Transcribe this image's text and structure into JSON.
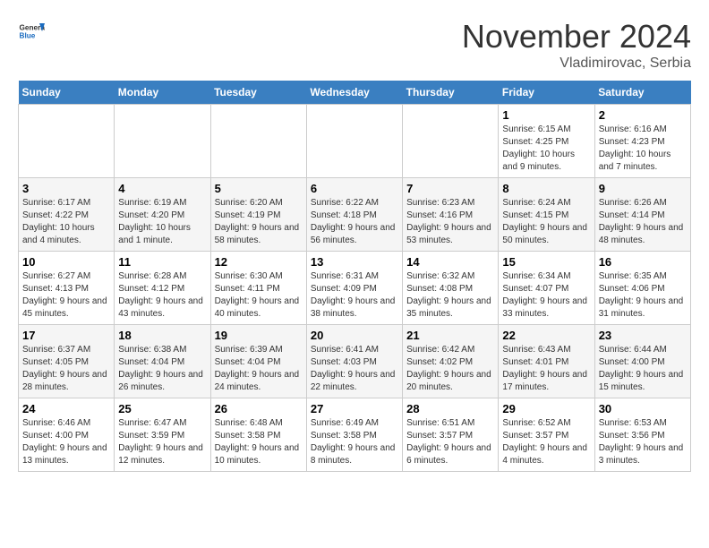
{
  "header": {
    "logo_general": "General",
    "logo_blue": "Blue",
    "month_title": "November 2024",
    "subtitle": "Vladimirovac, Serbia"
  },
  "days_of_week": [
    "Sunday",
    "Monday",
    "Tuesday",
    "Wednesday",
    "Thursday",
    "Friday",
    "Saturday"
  ],
  "weeks": [
    [
      {
        "day": "",
        "info": ""
      },
      {
        "day": "",
        "info": ""
      },
      {
        "day": "",
        "info": ""
      },
      {
        "day": "",
        "info": ""
      },
      {
        "day": "",
        "info": ""
      },
      {
        "day": "1",
        "info": "Sunrise: 6:15 AM\nSunset: 4:25 PM\nDaylight: 10 hours and 9 minutes."
      },
      {
        "day": "2",
        "info": "Sunrise: 6:16 AM\nSunset: 4:23 PM\nDaylight: 10 hours and 7 minutes."
      }
    ],
    [
      {
        "day": "3",
        "info": "Sunrise: 6:17 AM\nSunset: 4:22 PM\nDaylight: 10 hours and 4 minutes."
      },
      {
        "day": "4",
        "info": "Sunrise: 6:19 AM\nSunset: 4:20 PM\nDaylight: 10 hours and 1 minute."
      },
      {
        "day": "5",
        "info": "Sunrise: 6:20 AM\nSunset: 4:19 PM\nDaylight: 9 hours and 58 minutes."
      },
      {
        "day": "6",
        "info": "Sunrise: 6:22 AM\nSunset: 4:18 PM\nDaylight: 9 hours and 56 minutes."
      },
      {
        "day": "7",
        "info": "Sunrise: 6:23 AM\nSunset: 4:16 PM\nDaylight: 9 hours and 53 minutes."
      },
      {
        "day": "8",
        "info": "Sunrise: 6:24 AM\nSunset: 4:15 PM\nDaylight: 9 hours and 50 minutes."
      },
      {
        "day": "9",
        "info": "Sunrise: 6:26 AM\nSunset: 4:14 PM\nDaylight: 9 hours and 48 minutes."
      }
    ],
    [
      {
        "day": "10",
        "info": "Sunrise: 6:27 AM\nSunset: 4:13 PM\nDaylight: 9 hours and 45 minutes."
      },
      {
        "day": "11",
        "info": "Sunrise: 6:28 AM\nSunset: 4:12 PM\nDaylight: 9 hours and 43 minutes."
      },
      {
        "day": "12",
        "info": "Sunrise: 6:30 AM\nSunset: 4:11 PM\nDaylight: 9 hours and 40 minutes."
      },
      {
        "day": "13",
        "info": "Sunrise: 6:31 AM\nSunset: 4:09 PM\nDaylight: 9 hours and 38 minutes."
      },
      {
        "day": "14",
        "info": "Sunrise: 6:32 AM\nSunset: 4:08 PM\nDaylight: 9 hours and 35 minutes."
      },
      {
        "day": "15",
        "info": "Sunrise: 6:34 AM\nSunset: 4:07 PM\nDaylight: 9 hours and 33 minutes."
      },
      {
        "day": "16",
        "info": "Sunrise: 6:35 AM\nSunset: 4:06 PM\nDaylight: 9 hours and 31 minutes."
      }
    ],
    [
      {
        "day": "17",
        "info": "Sunrise: 6:37 AM\nSunset: 4:05 PM\nDaylight: 9 hours and 28 minutes."
      },
      {
        "day": "18",
        "info": "Sunrise: 6:38 AM\nSunset: 4:04 PM\nDaylight: 9 hours and 26 minutes."
      },
      {
        "day": "19",
        "info": "Sunrise: 6:39 AM\nSunset: 4:04 PM\nDaylight: 9 hours and 24 minutes."
      },
      {
        "day": "20",
        "info": "Sunrise: 6:41 AM\nSunset: 4:03 PM\nDaylight: 9 hours and 22 minutes."
      },
      {
        "day": "21",
        "info": "Sunrise: 6:42 AM\nSunset: 4:02 PM\nDaylight: 9 hours and 20 minutes."
      },
      {
        "day": "22",
        "info": "Sunrise: 6:43 AM\nSunset: 4:01 PM\nDaylight: 9 hours and 17 minutes."
      },
      {
        "day": "23",
        "info": "Sunrise: 6:44 AM\nSunset: 4:00 PM\nDaylight: 9 hours and 15 minutes."
      }
    ],
    [
      {
        "day": "24",
        "info": "Sunrise: 6:46 AM\nSunset: 4:00 PM\nDaylight: 9 hours and 13 minutes."
      },
      {
        "day": "25",
        "info": "Sunrise: 6:47 AM\nSunset: 3:59 PM\nDaylight: 9 hours and 12 minutes."
      },
      {
        "day": "26",
        "info": "Sunrise: 6:48 AM\nSunset: 3:58 PM\nDaylight: 9 hours and 10 minutes."
      },
      {
        "day": "27",
        "info": "Sunrise: 6:49 AM\nSunset: 3:58 PM\nDaylight: 9 hours and 8 minutes."
      },
      {
        "day": "28",
        "info": "Sunrise: 6:51 AM\nSunset: 3:57 PM\nDaylight: 9 hours and 6 minutes."
      },
      {
        "day": "29",
        "info": "Sunrise: 6:52 AM\nSunset: 3:57 PM\nDaylight: 9 hours and 4 minutes."
      },
      {
        "day": "30",
        "info": "Sunrise: 6:53 AM\nSunset: 3:56 PM\nDaylight: 9 hours and 3 minutes."
      }
    ]
  ]
}
